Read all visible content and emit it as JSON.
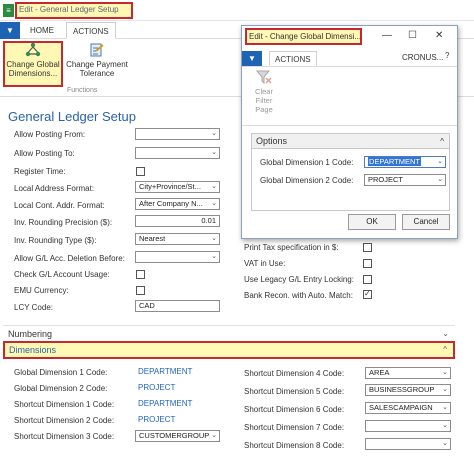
{
  "main": {
    "window_title": "Edit - General Ledger Setup",
    "tabs": [
      "HOME",
      "ACTIONS"
    ],
    "ribbon": {
      "change_global_dimensions": "Change Global Dimensions...",
      "change_payment_tolerance": "Change Payment Tolerance",
      "group_label": "Functions"
    },
    "page_title": "General Ledger Setup",
    "general_left": [
      {
        "label": "Allow Posting From:",
        "type": "dropdown",
        "value": ""
      },
      {
        "label": "Allow Posting To:",
        "type": "dropdown",
        "value": ""
      },
      {
        "label": "Register Time:",
        "type": "checkbox",
        "checked": false
      },
      {
        "label": "Local Address Format:",
        "type": "dropdown",
        "value": "City+Province/St..."
      },
      {
        "label": "Local Cont. Addr. Format:",
        "type": "dropdown",
        "value": "After Company N..."
      },
      {
        "label": "Inv. Rounding Precision ($):",
        "type": "number",
        "value": "0.01"
      },
      {
        "label": "Inv. Rounding Type ($):",
        "type": "dropdown",
        "value": "Nearest"
      },
      {
        "label": "Allow G/L Acc. Deletion Before:",
        "type": "dropdown",
        "value": ""
      },
      {
        "label": "Check G/L Account Usage:",
        "type": "checkbox",
        "checked": false
      },
      {
        "label": "EMU Currency:",
        "type": "checkbox",
        "checked": false
      },
      {
        "label": "LCY Code:",
        "type": "text",
        "value": "CAD"
      }
    ],
    "general_right": [
      {
        "label": "Print Tax specification in $:",
        "checked": false
      },
      {
        "label": "VAT in Use:",
        "checked": false
      },
      {
        "label": "Use Legacy G/L Entry Locking:",
        "checked": false
      },
      {
        "label": "Bank Recon. with Auto. Match:",
        "checked": true
      }
    ],
    "numbering_tab": "Numbering",
    "dimensions_tab": "Dimensions",
    "dimensions_left": [
      {
        "label": "Global Dimension 1 Code:",
        "value": "DEPARTMENT",
        "type": "link"
      },
      {
        "label": "Global Dimension 2 Code:",
        "value": "PROJECT",
        "type": "link"
      },
      {
        "label": "Shortcut Dimension 1 Code:",
        "value": "DEPARTMENT",
        "type": "link"
      },
      {
        "label": "Shortcut Dimension 2 Code:",
        "value": "PROJECT",
        "type": "link"
      },
      {
        "label": "Shortcut Dimension 3 Code:",
        "value": "CUSTOMERGROUP",
        "type": "dropdown"
      }
    ],
    "dimensions_right": [
      {
        "label": "Shortcut Dimension 4 Code:",
        "value": "AREA"
      },
      {
        "label": "Shortcut Dimension 5 Code:",
        "value": "BUSINESSGROUP"
      },
      {
        "label": "Shortcut Dimension 6 Code:",
        "value": "SALESCAMPAIGN"
      },
      {
        "label": "Shortcut Dimension 7 Code:",
        "value": ""
      },
      {
        "label": "Shortcut Dimension 8 Code:",
        "value": ""
      }
    ]
  },
  "dialog": {
    "title": "Edit - Change Global Dimensi...",
    "tab": "ACTIONS",
    "company": "CRONUS...",
    "clear_filter": "Clear Filter Page",
    "options_header": "Options",
    "fields": [
      {
        "label": "Global Dimension 1 Code:",
        "value": "DEPARTMENT",
        "selected": true
      },
      {
        "label": "Global Dimension 2 Code:",
        "value": "PROJECT",
        "selected": false
      }
    ],
    "ok_label": "OK",
    "cancel_label": "Cancel"
  },
  "colors": {
    "accent_blue": "#1f64b4",
    "link_blue": "#1e63c7",
    "highlight_fill": "#fff8b5",
    "highlight_border": "#c5282f",
    "selection_blue": "#3375d6"
  }
}
